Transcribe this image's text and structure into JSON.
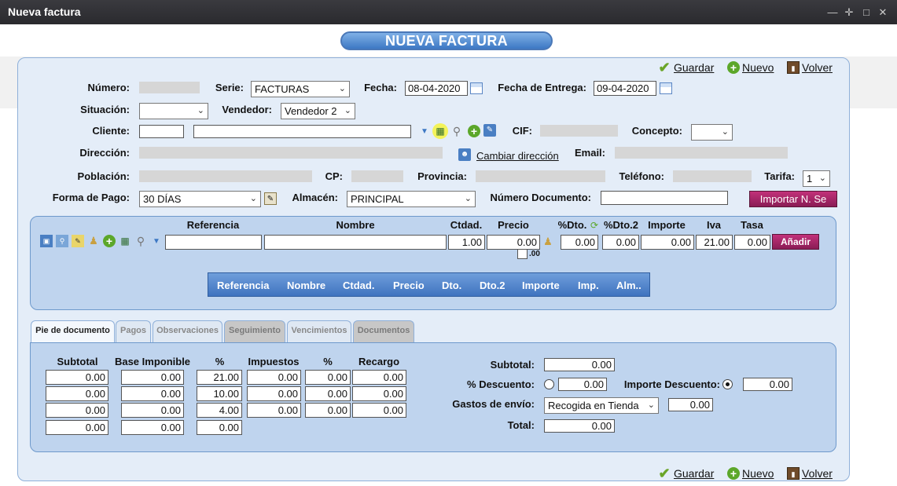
{
  "window": {
    "title": "Nueva factura"
  },
  "page_title": "NUEVA FACTURA",
  "actions": {
    "guardar": "Guardar",
    "nuevo": "Nuevo",
    "volver": "Volver"
  },
  "header_form": {
    "numero_label": "Número:",
    "serie_label": "Serie:",
    "serie_value": "FACTURAS",
    "fecha_label": "Fecha:",
    "fecha_value": "08-04-2020",
    "fecha_entrega_label": "Fecha de Entrega:",
    "fecha_entrega_value": "09-04-2020",
    "situacion_label": "Situación:",
    "situacion_value": "",
    "vendedor_label": "Vendedor:",
    "vendedor_value": "Vendedor 2",
    "cliente_label": "Cliente:",
    "cif_label": "CIF:",
    "concepto_label": "Concepto:",
    "concepto_value": "",
    "direccion_label": "Dirección:",
    "cambiar_direccion": "Cambiar dirección",
    "email_label": "Email:",
    "poblacion_label": "Población:",
    "cp_label": "CP:",
    "provincia_label": "Provincia:",
    "telefono_label": "Teléfono:",
    "tarifa_label": "Tarifa:",
    "tarifa_value": "1",
    "forma_pago_label": "Forma de Pago:",
    "forma_pago_value": "30 DÍAS",
    "almacen_label": "Almacén:",
    "almacen_value": "PRINCIPAL",
    "numero_documento_label": "Número Documento:",
    "importar_button": "Importar N. Se"
  },
  "line_entry": {
    "headers": {
      "referencia": "Referencia",
      "nombre": "Nombre",
      "ctdad": "Ctdad.",
      "precio": "Precio",
      "dto": "%Dto.",
      "dto2": "%Dto.2",
      "importe": "Importe",
      "iva": "Iva",
      "tasa": "Tasa"
    },
    "values": {
      "ctdad": "1.00",
      "precio": "0.00",
      "dto": "0.00",
      "dto2": "0.00",
      "importe": "0.00",
      "iva": "21.00",
      "tasa": "0.00",
      "decimals_hint": ".00"
    },
    "anadir_button": "Añadir"
  },
  "grid_columns": [
    "Referencia",
    "Nombre",
    "Ctdad.",
    "Precio",
    "Dto.",
    "Dto.2",
    "Importe",
    "Imp.",
    "Alm.."
  ],
  "tabs": [
    "Pie de documento",
    "Pagos",
    "Observaciones",
    "Seguimiento",
    "Vencimientos",
    "Documentos"
  ],
  "footer": {
    "table_headers": [
      "Subtotal",
      "Base Imponible",
      "%",
      "Impuestos",
      "%",
      "Recargo"
    ],
    "rows": [
      [
        "0.00",
        "0.00",
        "21.00",
        "0.00",
        "0.00",
        "0.00"
      ],
      [
        "0.00",
        "0.00",
        "10.00",
        "0.00",
        "0.00",
        "0.00"
      ],
      [
        "0.00",
        "0.00",
        "4.00",
        "0.00",
        "0.00",
        "0.00"
      ],
      [
        "0.00",
        "0.00",
        "0.00"
      ]
    ],
    "subtotal_label": "Subtotal:",
    "subtotal_value": "0.00",
    "descuento_label": "% Descuento:",
    "descuento_value": "0.00",
    "importe_descuento_label": "Importe Descuento:",
    "importe_descuento_value": "0.00",
    "gastos_envio_label": "Gastos de envío:",
    "gastos_envio_option": "Recogida en Tienda",
    "gastos_envio_value": "0.00",
    "total_label": "Total:",
    "total_value": "0.00"
  },
  "colors": {
    "titlebar": "#2f2f33",
    "accent_blue": "#3d78c4",
    "panel_bg": "#e4edf8",
    "magenta_button": "#a8246a"
  }
}
